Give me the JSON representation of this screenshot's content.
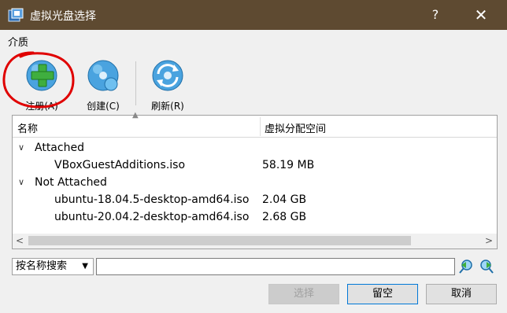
{
  "window": {
    "title": "虚拟光盘选择",
    "help_glyph": "?",
    "close_glyph": "✕"
  },
  "menu": {
    "items": [
      {
        "label": "介质"
      }
    ]
  },
  "toolbar": {
    "register_label": "注册(A)",
    "create_label": "创建(C)",
    "refresh_label": "刷新(R)"
  },
  "list": {
    "columns": [
      "名称",
      "虚拟分配空间"
    ],
    "groups": [
      {
        "label": "Attached",
        "expanded": true,
        "items": [
          {
            "name": "VBoxGuestAdditions.iso",
            "size": "58.19 MB"
          }
        ]
      },
      {
        "label": "Not Attached",
        "expanded": true,
        "items": [
          {
            "name": "ubuntu-18.04.5-desktop-amd64.iso",
            "size": "2.04 GB"
          },
          {
            "name": "ubuntu-20.04.2-desktop-amd64.iso",
            "size": "2.68 GB"
          }
        ]
      }
    ]
  },
  "search": {
    "mode": "按名称搜索",
    "value": ""
  },
  "buttons": {
    "choose": "选择",
    "leave_empty": "留空",
    "cancel": "取消"
  },
  "colors": {
    "titlebar": "#5e4a31",
    "annotation": "#e00000"
  }
}
